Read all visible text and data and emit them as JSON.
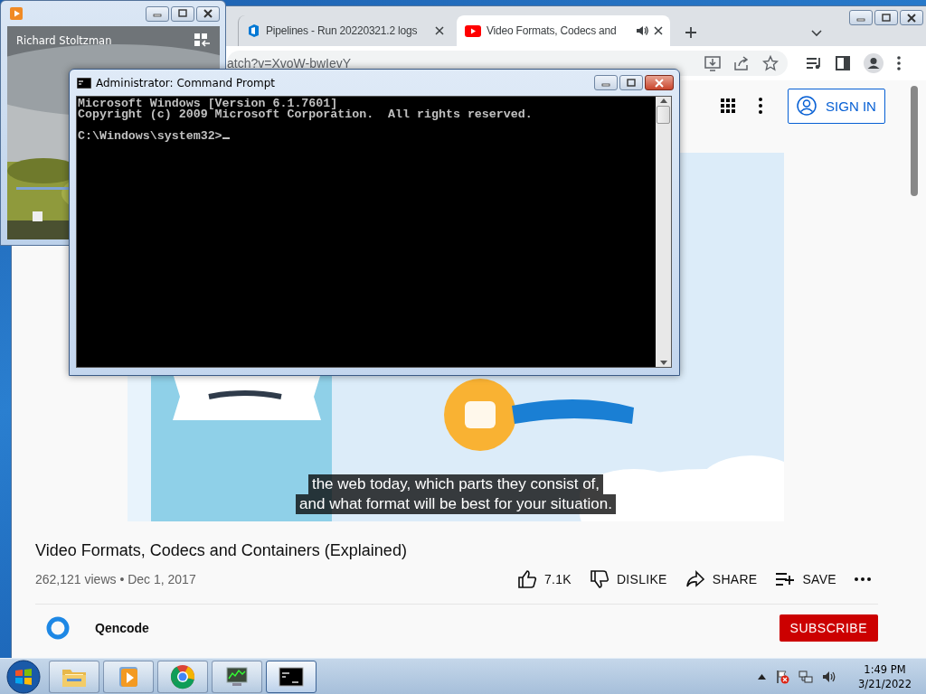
{
  "browser": {
    "tabs": [
      {
        "label": "Pipelines - Run 20220321.2 logs",
        "selected": false,
        "audio": false,
        "kind": "pipelines"
      },
      {
        "label": "Video Formats, Codecs and",
        "selected": true,
        "audio": true,
        "kind": "video"
      }
    ],
    "address": "atch?v=XvoW-bwIevY",
    "sign_in": "SIGN IN",
    "video": {
      "kind": "picture",
      "captions": [
        "the web today, which parts they consist of,",
        "and what format will be best for your situation."
      ]
    },
    "title": "Video Formats, Codecs and Containers (Explained)",
    "meta": "262,121 views • Dec 1, 2017",
    "actions": [
      {
        "kind": "like",
        "label": "7.1K"
      },
      {
        "kind": "dislike",
        "label": "DISLIKE"
      },
      {
        "kind": "share",
        "label": "SHARE"
      },
      {
        "kind": "save",
        "label": "SAVE"
      },
      {
        "kind": "more"
      }
    ],
    "channel": "Qencode",
    "subscribe": "SUBSCRIBE"
  },
  "media_player": {
    "track": "Richard Stoltzman"
  },
  "command_prompt": {
    "title": "Administrator: Command Prompt",
    "lines": [
      "Microsoft Windows [Version 6.1.7601]",
      "Copyright (c) 2009 Microsoft Corporation.  All rights reserved."
    ],
    "prompt": "C:\\Windows\\system32>"
  },
  "taskbar": {
    "apps": [
      {
        "kind": "explorer",
        "selected": false
      },
      {
        "kind": "media",
        "selected": false
      },
      {
        "kind": "chrome",
        "selected": false
      },
      {
        "kind": "monitor",
        "selected": false
      },
      {
        "kind": "cmd",
        "selected": true
      }
    ],
    "time": "1:49 PM",
    "date": "3/21/2022"
  }
}
